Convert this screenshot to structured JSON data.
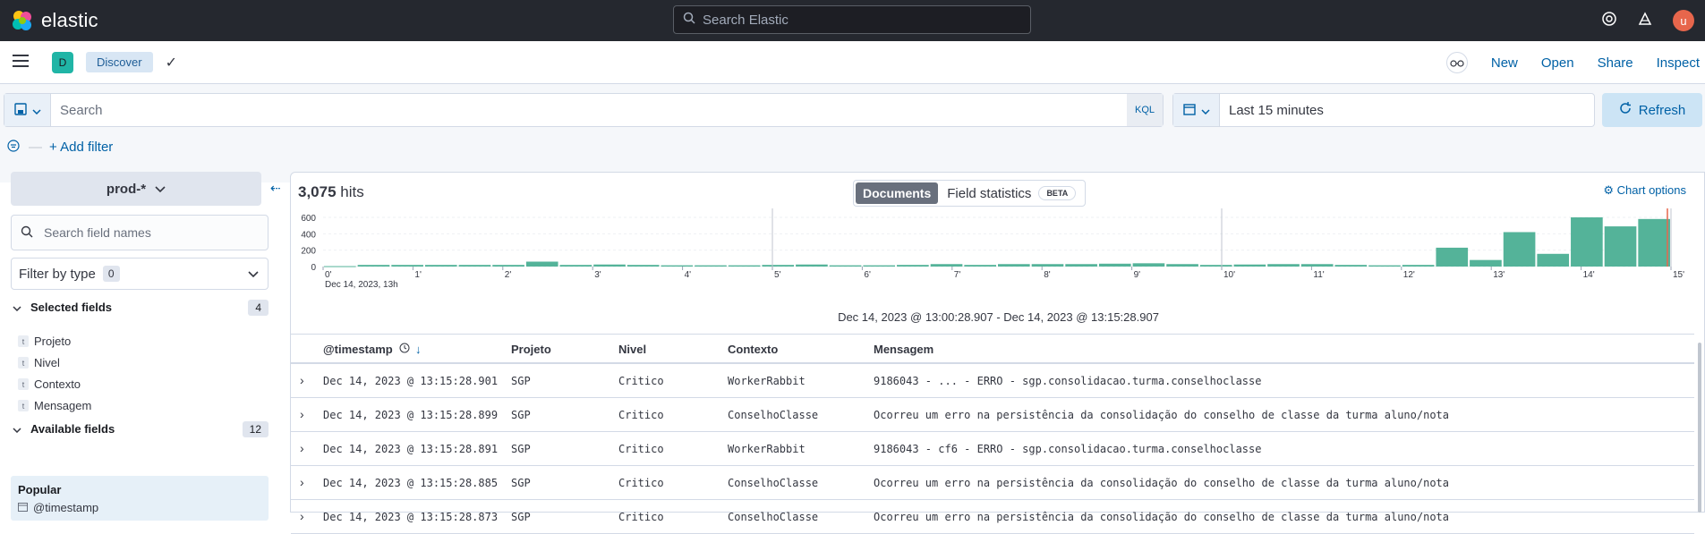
{
  "header": {
    "brand": "elastic",
    "search_placeholder": "Search Elastic",
    "avatar_initial": "u"
  },
  "subbar": {
    "space_initial": "D",
    "breadcrumb": "Discover",
    "links": {
      "new": "New",
      "open": "Open",
      "share": "Share",
      "inspect": "Inspect"
    }
  },
  "query": {
    "placeholder": "Search",
    "language": "KQL",
    "time_range": "Last 15 minutes",
    "refresh_label": "Refresh",
    "add_filter": "+ Add filter"
  },
  "sidebar": {
    "index_pattern": "prod-*",
    "field_search_placeholder": "Search field names",
    "filter_by_type": "Filter by type",
    "filter_by_type_count": "0",
    "selected_fields_label": "Selected fields",
    "selected_fields_count": "4",
    "selected_fields": [
      "Projeto",
      "Nivel",
      "Contexto",
      "Mensagem"
    ],
    "available_fields_label": "Available fields",
    "available_fields_count": "12",
    "popular_label": "Popular",
    "popular_first": "@timestamp"
  },
  "main": {
    "hits_count": "3,075",
    "hits_label": "hits",
    "tab_documents": "Documents",
    "tab_field_statistics": "Field statistics",
    "beta": "BETA",
    "chart_options": "Chart options",
    "date_range": "Dec 14, 2023 @ 13:00:28.907 - Dec 14, 2023 @ 13:15:28.907"
  },
  "chart_data": {
    "type": "bar",
    "ylim": [
      0,
      600
    ],
    "y_ticks": [
      "600",
      "400",
      "200",
      "0"
    ],
    "x_ticks": [
      "0'",
      "1'",
      "2'",
      "3'",
      "4'",
      "5'",
      "6'",
      "7'",
      "8'",
      "9'",
      "10'",
      "11'",
      "12'",
      "13'",
      "14'",
      "15'"
    ],
    "x_sublabel": "Dec 14, 2023, 13h",
    "values": [
      5,
      20,
      20,
      20,
      20,
      20,
      60,
      20,
      25,
      20,
      15,
      15,
      15,
      20,
      25,
      15,
      15,
      20,
      30,
      20,
      30,
      30,
      30,
      35,
      40,
      30,
      20,
      25,
      30,
      30,
      20,
      15,
      20,
      230,
      80,
      420,
      155,
      600,
      490,
      580
    ],
    "color": "#54b399"
  },
  "table": {
    "columns": [
      "@timestamp",
      "Projeto",
      "Nivel",
      "Contexto",
      "Mensagem"
    ],
    "rows": [
      {
        "timestamp": "Dec 14, 2023 @ 13:15:28.901",
        "projeto": "SGP",
        "nivel": "Critico",
        "contexto": "WorkerRabbit",
        "mensagem": "9186043 - ... - ERRO - sgp.consolidacao.turma.conselhoclasse"
      },
      {
        "timestamp": "Dec 14, 2023 @ 13:15:28.899",
        "projeto": "SGP",
        "nivel": "Critico",
        "contexto": "ConselhoClasse",
        "mensagem": "Ocorreu um erro na persistência da consolidação do conselho de classe da turma aluno/nota"
      },
      {
        "timestamp": "Dec 14, 2023 @ 13:15:28.891",
        "projeto": "SGP",
        "nivel": "Critico",
        "contexto": "WorkerRabbit",
        "mensagem": "9186043 - cf6 - ERRO - sgp.consolidacao.turma.conselhoclasse"
      },
      {
        "timestamp": "Dec 14, 2023 @ 13:15:28.885",
        "projeto": "SGP",
        "nivel": "Critico",
        "contexto": "ConselhoClasse",
        "mensagem": "Ocorreu um erro na persistência da consolidação do conselho de classe da turma aluno/nota"
      },
      {
        "timestamp": "Dec 14, 2023 @ 13:15:28.873",
        "projeto": "SGP",
        "nivel": "Critico",
        "contexto": "ConselhoClasse",
        "mensagem": "Ocorreu um erro na persistência da consolidação do conselho de classe da turma aluno/nota"
      }
    ]
  }
}
